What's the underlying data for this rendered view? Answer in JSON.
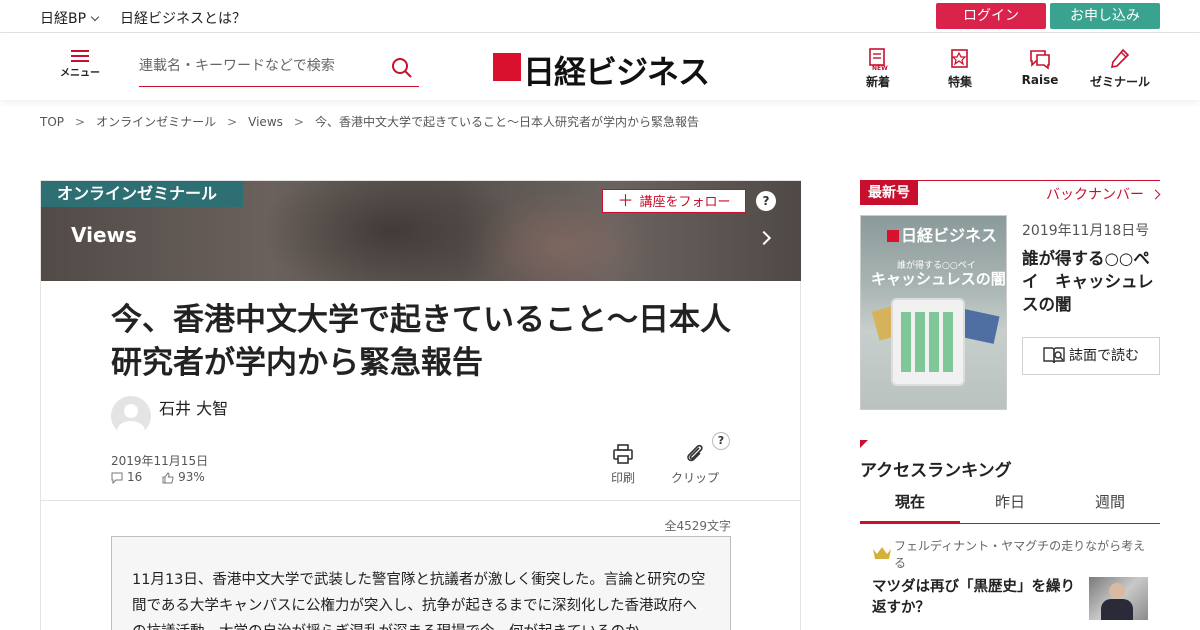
{
  "topbar": {
    "nikkei_bp": "日経BP",
    "about": "日経ビジネスとは？",
    "login": "ログイン",
    "apply": "お申し込み"
  },
  "header": {
    "menu_label": "メニュー",
    "search_placeholder": "連載名・キーワードなどで検索",
    "logo_text": "日経ビジネス",
    "nav": [
      {
        "label": "新着",
        "icon": "new-icon"
      },
      {
        "label": "特集",
        "icon": "feature-icon"
      },
      {
        "label": "Raise",
        "icon": "raise-icon"
      },
      {
        "label": "ゼミナール",
        "icon": "pen-icon"
      }
    ]
  },
  "breadcrumb": [
    "TOP",
    "オンラインゼミナール",
    "Views",
    "今、香港中文大学で起きていること〜日本人研究者が学内から緊急報告"
  ],
  "breadcrumb_sep": ">",
  "article": {
    "category": "オンラインゼミナール",
    "series": "Views",
    "follow": "講座をフォロー",
    "help": "?",
    "title": "今、香港中文大学で起きていること〜日本人研究者が学内から緊急報告",
    "author": "石井 大智",
    "date": "2019年11月15日",
    "comments": "16",
    "likes": "93%",
    "print_label": "印刷",
    "clip_label": "クリップ",
    "word_count": "全4529文字",
    "lead": "11月13日、香港中文大学で武装した警官隊と抗議者が激しく衝突した。言論と研究の空間である大学キャンパスに公権力が突入し、抗争が起きるまでに深刻化した香港政府への抗議活動。大学の自治が揺らぎ混乱が深まる現場で今、何が起きているのか。"
  },
  "sidebar": {
    "latest_tag": "最新号",
    "back_numbers": "バックナンバー",
    "cover_logo": "日経ビジネス",
    "cover_sub": "誰が得する○○ペイ",
    "cover_main": "キャッシュレスの闇",
    "issue_date": "2019年11月18日号",
    "issue_title": "誰が得する○○ペイ　キャッシュレスの闇",
    "read_button": "誌面で読む",
    "ranking_title": "アクセスランキング",
    "ranking_tabs": [
      "現在",
      "昨日",
      "週間"
    ],
    "ranking_item": {
      "kicker": "フェルディナント・ヤマグチの走りながら考える",
      "headline": "マツダは再び「黒歴史」を繰り返すか？"
    }
  },
  "colors": {
    "accent_red": "#c8102e",
    "login_red": "#d9234a",
    "apply_green": "#3aa38f",
    "category_teal": "#2d6f73"
  }
}
